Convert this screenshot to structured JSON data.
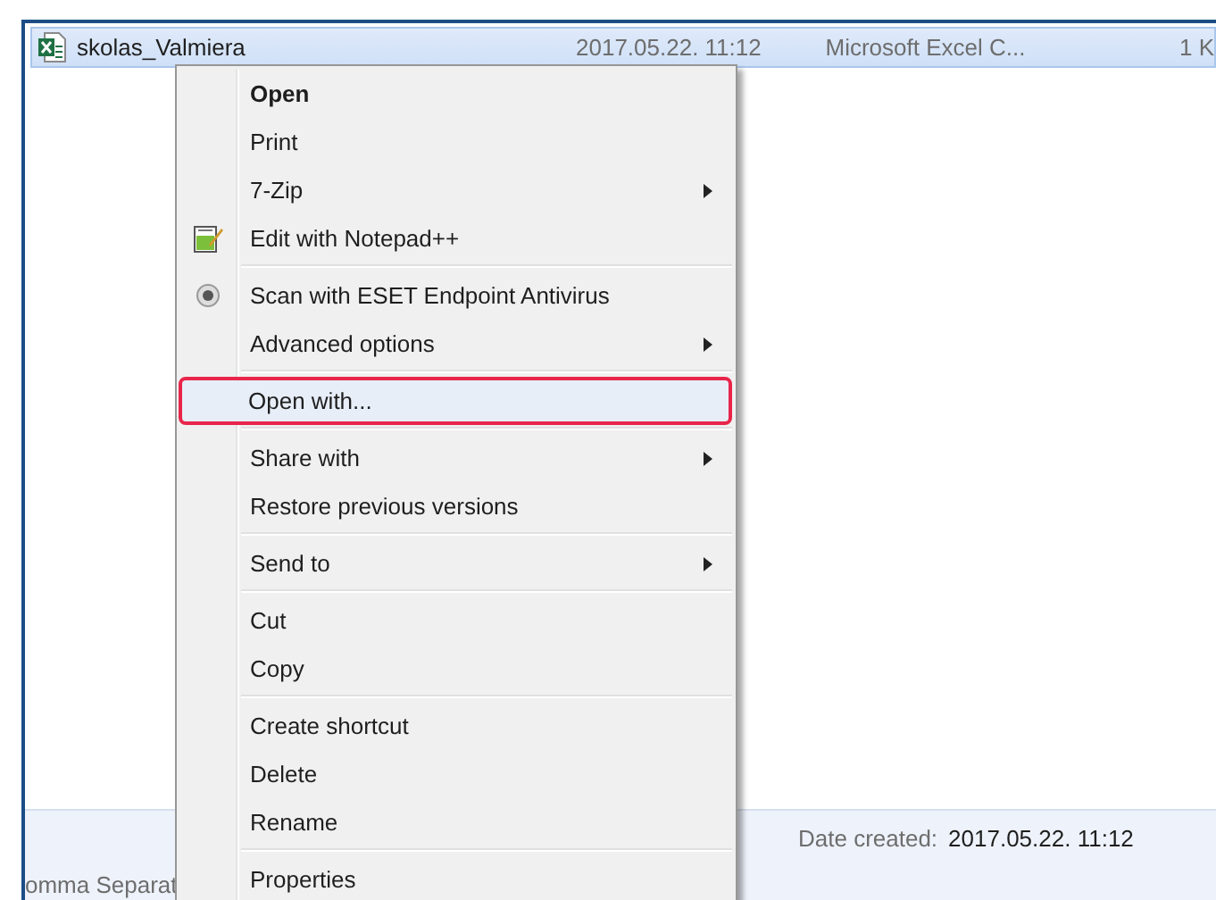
{
  "file_list": {
    "rows": [
      {
        "name": "skolas_Valmiera",
        "date_modified": "2017.05.22. 11:12",
        "type": "Microsoft Excel C...",
        "size": "1 K",
        "selected": true
      }
    ]
  },
  "context_menu": {
    "items": [
      {
        "kind": "item",
        "label": "Open",
        "bold": true,
        "submenu": false,
        "highlighted": false
      },
      {
        "kind": "item",
        "label": "Print",
        "bold": false,
        "submenu": false,
        "highlighted": false
      },
      {
        "kind": "item",
        "label": "7-Zip",
        "bold": false,
        "submenu": true,
        "highlighted": false
      },
      {
        "kind": "notepad_item",
        "label": "Edit with Notepad++",
        "bold": false,
        "submenu": false,
        "highlighted": false
      },
      {
        "kind": "separator"
      },
      {
        "kind": "scan_item",
        "label": "Scan with ESET Endpoint Antivirus",
        "bold": false,
        "submenu": false,
        "highlighted": false
      },
      {
        "kind": "item",
        "label": "Advanced options",
        "bold": false,
        "submenu": true,
        "highlighted": false
      },
      {
        "kind": "separator"
      },
      {
        "kind": "item",
        "label": "Open with...",
        "bold": false,
        "submenu": false,
        "highlighted": true
      },
      {
        "kind": "separator"
      },
      {
        "kind": "item",
        "label": "Share with",
        "bold": false,
        "submenu": true,
        "highlighted": false
      },
      {
        "kind": "item",
        "label": "Restore previous versions",
        "bold": false,
        "submenu": false,
        "highlighted": false
      },
      {
        "kind": "separator"
      },
      {
        "kind": "item",
        "label": "Send to",
        "bold": false,
        "submenu": true,
        "highlighted": false
      },
      {
        "kind": "separator"
      },
      {
        "kind": "item",
        "label": "Cut",
        "bold": false,
        "submenu": false,
        "highlighted": false
      },
      {
        "kind": "item",
        "label": "Copy",
        "bold": false,
        "submenu": false,
        "highlighted": false
      },
      {
        "kind": "separator"
      },
      {
        "kind": "item",
        "label": "Create shortcut",
        "bold": false,
        "submenu": false,
        "highlighted": false
      },
      {
        "kind": "item",
        "label": "Delete",
        "bold": false,
        "submenu": false,
        "highlighted": false
      },
      {
        "kind": "item",
        "label": "Rename",
        "bold": false,
        "submenu": false,
        "highlighted": false
      },
      {
        "kind": "separator"
      },
      {
        "kind": "item",
        "label": "Properties",
        "bold": false,
        "submenu": false,
        "highlighted": false
      }
    ]
  },
  "details_pane": {
    "type_text": "omma Separat",
    "date_created_label": "Date created:",
    "date_created_value": "2017.05.22. 11:12"
  }
}
